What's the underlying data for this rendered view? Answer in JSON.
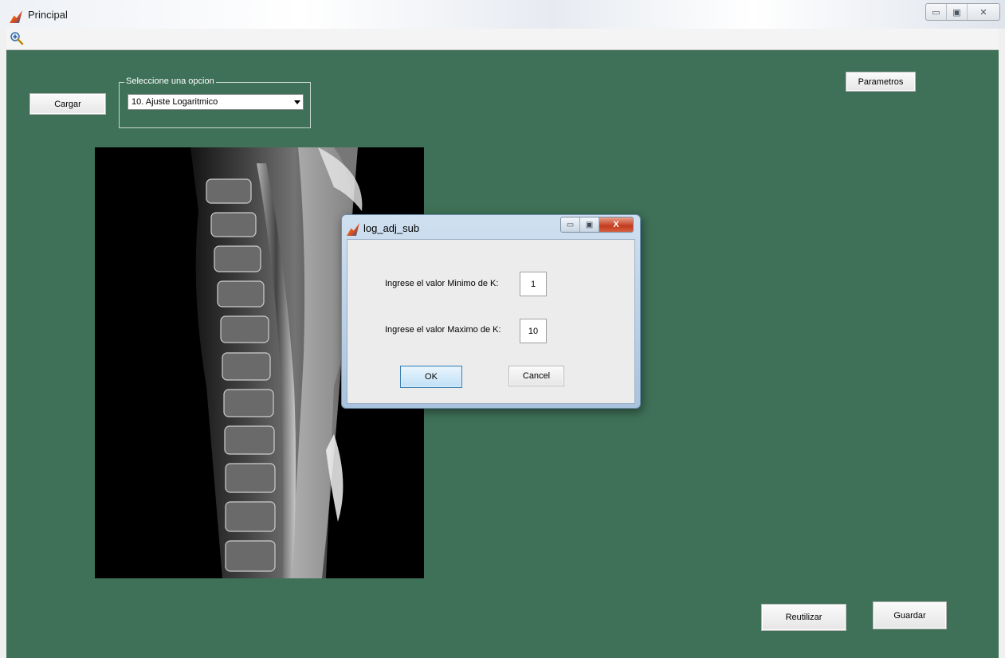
{
  "window": {
    "title": "Principal",
    "caption_minimize": "▭",
    "caption_maximize": "▣",
    "caption_close": "✕"
  },
  "toolbar": {
    "zoom_icon": "zoom-in-icon"
  },
  "colors": {
    "figure_background": "#3f7158",
    "dialog_frame": "#a9c3de"
  },
  "main": {
    "load_button": "Cargar",
    "parameters_button": "Parametros",
    "option_panel_title": "Seleccione una opcion",
    "option_selected": "10. Ajuste Logaritmico",
    "reuse_button": "Reutilizar",
    "save_button": "Guardar"
  },
  "dialog": {
    "title": "log_adj_sub",
    "min_k_label": "Ingrese el valor Minimo de K:",
    "min_k_value": "1",
    "max_k_label": "Ingrese el valor Maximo de K:",
    "max_k_value": "10",
    "ok_button": "OK",
    "cancel_button": "Cancel",
    "caption_minimize": "▭",
    "caption_maximize": "▣",
    "caption_close": "X"
  }
}
